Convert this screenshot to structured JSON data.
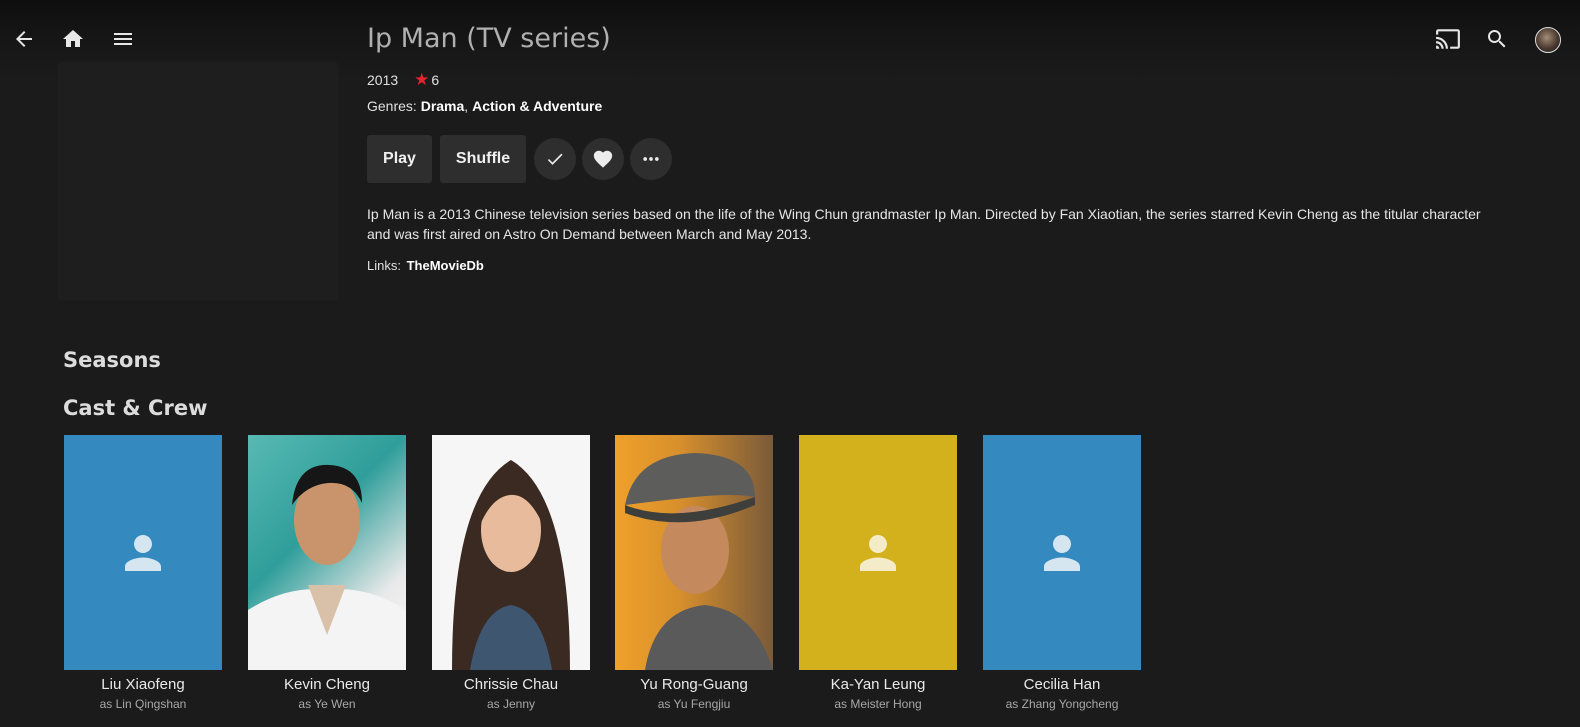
{
  "header": {
    "back_icon": "arrow-left-icon",
    "home_icon": "home-icon",
    "menu_icon": "hamburger-menu-icon",
    "cast_icon": "cast-icon",
    "search_icon": "search-icon",
    "avatar_icon": "user-avatar"
  },
  "item": {
    "title": "Ip Man (TV series)",
    "year": "2013",
    "rating_icon": "star-icon",
    "rating": "6",
    "genres_label": "Genres:",
    "genres": [
      "Drama",
      "Action & Adventure"
    ],
    "genre_sep": ", ",
    "play_label": "Play",
    "shuffle_label": "Shuffle",
    "played_icon": "check-icon",
    "favorite_icon": "heart-icon",
    "more_icon": "more-horizontal-icon",
    "overview": "Ip Man is a 2013 Chinese television series based on the life of the Wing Chun grandmaster Ip Man. Directed by Fan Xiaotian, the series starred Kevin Cheng as the titular character and was first aired on Astro On Demand between March and May 2013.",
    "links_label": "Links:",
    "links": [
      "TheMovieDb"
    ]
  },
  "sections": {
    "seasons": "Seasons",
    "cast": "Cast & Crew"
  },
  "cast": [
    {
      "name": "Liu Xiaofeng",
      "role": "as Lin Qingshan",
      "image": "placeholder",
      "color": "#3489bf"
    },
    {
      "name": "Kevin Cheng",
      "role": "as Ye Wen",
      "image": "photo",
      "color": "#2f9e9a"
    },
    {
      "name": "Chrissie Chau",
      "role": "as Jenny",
      "image": "photo",
      "color": "#f4f4f4"
    },
    {
      "name": "Yu Rong-Guang",
      "role": "as Yu Fengjiu",
      "image": "photo",
      "color": "#c38a2a"
    },
    {
      "name": "Ka-Yan Leung",
      "role": "as Meister Hong",
      "image": "placeholder",
      "color": "#d2b11c"
    },
    {
      "name": "Cecilia Han",
      "role": "as Zhang Yongcheng",
      "image": "placeholder",
      "color": "#3489bf"
    }
  ]
}
